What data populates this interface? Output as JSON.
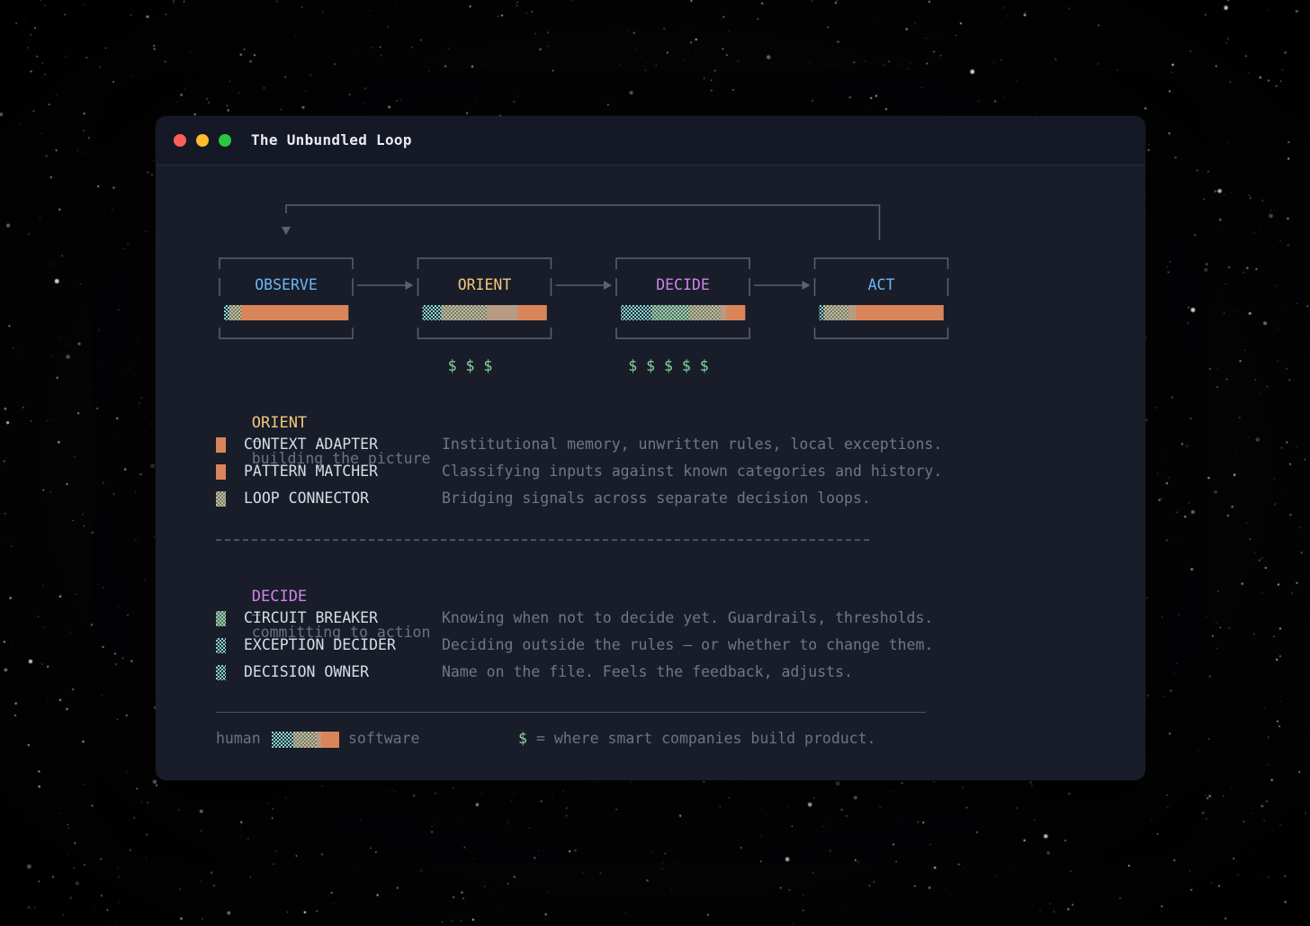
{
  "window": {
    "title": "The Unbundled Loop"
  },
  "stages": [
    {
      "label": "OBSERVE",
      "color": "#6cb6f2",
      "cost": "",
      "bar": [
        {
          "kind": "human",
          "pct": 4
        },
        {
          "kind": "mix",
          "pct": 10
        },
        {
          "kind": "software",
          "pct": 86
        }
      ]
    },
    {
      "label": "ORIENT",
      "color": "#f3c77b",
      "cost": "$ $ $",
      "bar": [
        {
          "kind": "human",
          "pct": 15
        },
        {
          "kind": "mix",
          "pct": 37
        },
        {
          "kind": "blend",
          "pct": 25
        },
        {
          "kind": "software",
          "pct": 23
        }
      ]
    },
    {
      "label": "DECIDE",
      "color": "#d183e8",
      "cost": "$ $ $ $ $",
      "bar": [
        {
          "kind": "human",
          "pct": 25
        },
        {
          "kind": "mostly",
          "pct": 30
        },
        {
          "kind": "mix",
          "pct": 25
        },
        {
          "kind": "blend",
          "pct": 5
        },
        {
          "kind": "software",
          "pct": 15
        }
      ]
    },
    {
      "label": "ACT",
      "color": "#6cb6f2",
      "cost": "",
      "bar": [
        {
          "kind": "human",
          "pct": 4
        },
        {
          "kind": "mix",
          "pct": 20
        },
        {
          "kind": "blend",
          "pct": 6
        },
        {
          "kind": "software",
          "pct": 70
        }
      ]
    }
  ],
  "colors": {
    "software": "#d98559",
    "cost": "#86d6a0",
    "connector": "#5a6272"
  },
  "orient_section": {
    "name": "ORIENT",
    "sep": "—",
    "subtitle": "building the picture",
    "items": [
      {
        "swatch": "solid",
        "name": "CONTEXT ADAPTER",
        "desc": "Institutional memory, unwritten rules, local exceptions."
      },
      {
        "swatch": "solid",
        "name": "PATTERN MATCHER",
        "desc": "Classifying inputs against known categories and history."
      },
      {
        "swatch": "mix",
        "name": "LOOP CONNECTOR",
        "desc": "Bridging signals across separate decision loops."
      }
    ]
  },
  "decide_section": {
    "name": "DECIDE",
    "sep": "—",
    "subtitle": "committing to action",
    "items": [
      {
        "swatch": "mostly",
        "name": "CIRCUIT BREAKER",
        "desc": "Knowing when not to decide yet. Guardrails, thresholds."
      },
      {
        "swatch": "human",
        "name": "EXCEPTION DECIDER",
        "desc": "Deciding outside the rules — or whether to change them."
      },
      {
        "swatch": "human",
        "name": "DECISION OWNER",
        "desc": "Name on the file. Feels the feedback, adjusts."
      }
    ]
  },
  "legend": {
    "left": "human",
    "right": "software",
    "symbol": "$",
    "note": "= where smart companies build product."
  }
}
